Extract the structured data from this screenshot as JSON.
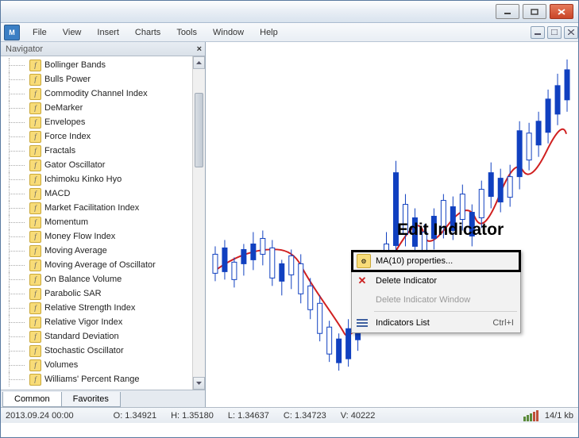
{
  "menu": {
    "file": "File",
    "view": "View",
    "insert": "Insert",
    "charts": "Charts",
    "tools": "Tools",
    "window": "Window",
    "help": "Help"
  },
  "navigator": {
    "title": "Navigator",
    "tabs": {
      "common": "Common",
      "favorites": "Favorites"
    },
    "items": [
      "Bollinger Bands",
      "Bulls Power",
      "Commodity Channel Index",
      "DeMarker",
      "Envelopes",
      "Force Index",
      "Fractals",
      "Gator Oscillator",
      "Ichimoku Kinko Hyo",
      "MACD",
      "Market Facilitation Index",
      "Momentum",
      "Money Flow Index",
      "Moving Average",
      "Moving Average of Oscillator",
      "On Balance Volume",
      "Parabolic SAR",
      "Relative Strength Index",
      "Relative Vigor Index",
      "Standard Deviation",
      "Stochastic Oscillator",
      "Volumes",
      "Williams' Percent Range"
    ]
  },
  "context_menu": {
    "properties": "MA(10) properties...",
    "delete": "Delete Indicator",
    "delete_window": "Delete Indicator Window",
    "list": "Indicators List",
    "list_shortcut": "Ctrl+I"
  },
  "annotation": "Edit Indicator",
  "status": {
    "datetime": "2013.09.24 00:00",
    "open": "O: 1.34921",
    "high": "H: 1.35180",
    "low": "L: 1.34637",
    "close": "C: 1.34723",
    "volume": "V: 40222",
    "kb": "14/1 kb"
  },
  "chart_data": {
    "type": "candlestick+line",
    "note": "Values estimated from pixel positions; no axis labels visible in source",
    "indicator": {
      "name": "MA(10)",
      "color": "#d02020"
    },
    "candles_estimated_pixel_y": "top≈80 bottom≈440, x left≈270 to right≈700",
    "trend": "ranging then strong bullish breakout upper-right"
  }
}
